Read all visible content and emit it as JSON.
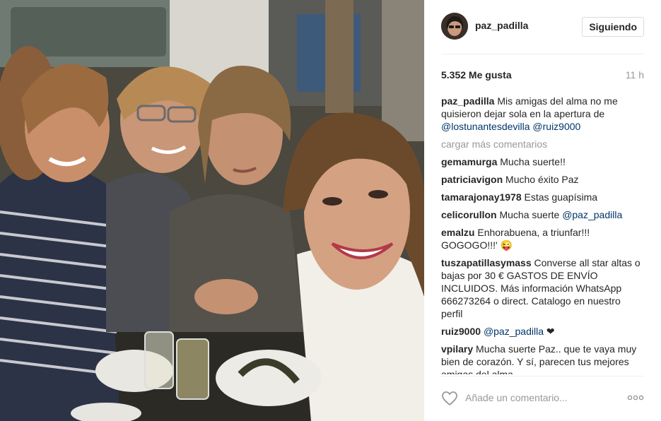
{
  "post": {
    "username": "paz_padilla",
    "follow_label": "Siguiendo",
    "likes": "5.352 Me gusta",
    "time": "11 h",
    "caption": {
      "user": "paz_padilla",
      "text": "Mis amigas del alma no me quisieron dejar sola en la apertura de",
      "mention1": "@lostunantesdevilla",
      "mention2": "@ruiz9000"
    },
    "load_more": "cargar más comentarios",
    "comments": [
      {
        "user": "gemamurga",
        "text": "Mucha suerte!!",
        "mention": ""
      },
      {
        "user": "patriciavigon",
        "text": "Mucho éxito Paz",
        "mention": ""
      },
      {
        "user": "tamarajonay1978",
        "text": "Estas guapísima",
        "mention": ""
      },
      {
        "user": "celicorullon",
        "text": "Mucha suerte",
        "mention": "@paz_padilla"
      },
      {
        "user": "emalzu",
        "text": "Enhorabuena, a triunfar!!! GOGOGO!!!' 😜",
        "mention": ""
      },
      {
        "user": "tuszapatillasymass",
        "text": "Converse all star altas o bajas por 30 € GASTOS DE ENVÍO INCLUIDOS. Más información WhatsApp 666273264 o direct. Catalogo en nuestro perfil",
        "mention": ""
      },
      {
        "user": "ruiz9000",
        "text": "❤",
        "mention": "@paz_padilla"
      },
      {
        "user": "vpilary",
        "text": "Mucha suerte Paz.. que te vaya muy bien de corazón. Y sí, parecen tus mejores amigas del alma",
        "mention": ""
      }
    ],
    "comment_placeholder": "Añade un comentario...",
    "colors": {
      "mention": "#003569",
      "muted": "#999999",
      "border": "#dbdbdb"
    }
  }
}
